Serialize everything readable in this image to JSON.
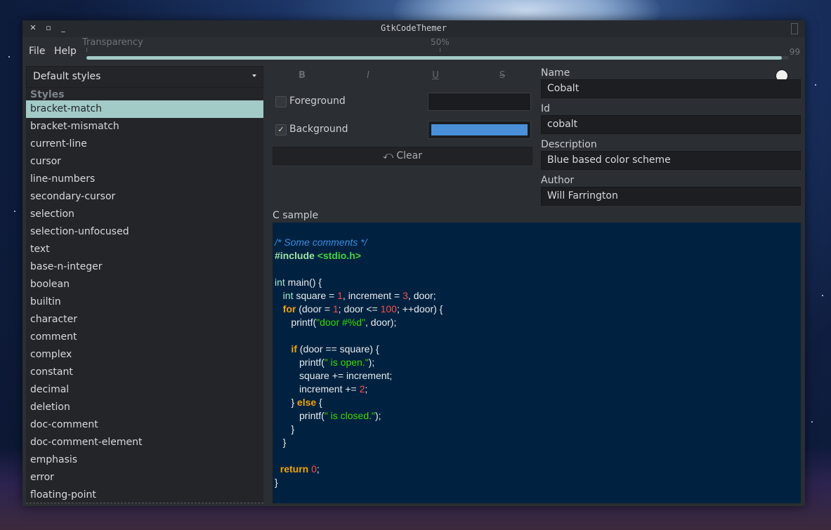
{
  "window": {
    "title": "GtkCodeThemer",
    "controls": [
      {
        "icon": "close-icon",
        "glyph": "✕"
      },
      {
        "icon": "maximize-icon",
        "glyph": "▫"
      },
      {
        "icon": "minimize-icon",
        "glyph": "_"
      }
    ]
  },
  "menu": {
    "file": "File",
    "help": "Help"
  },
  "transparency": {
    "caption": "Transparency",
    "mid_mark": "50%",
    "value": "99",
    "fraction": 0.99
  },
  "scheme_select": {
    "selected": "Default styles"
  },
  "styles_list": {
    "header": "Styles",
    "items": [
      "bracket-match",
      "bracket-mismatch",
      "current-line",
      "cursor",
      "line-numbers",
      "secondary-cursor",
      "selection",
      "selection-unfocused",
      "text",
      "base-n-integer",
      "boolean",
      "builtin",
      "character",
      "comment",
      "complex",
      "constant",
      "decimal",
      "deletion",
      "doc-comment",
      "doc-comment-element",
      "emphasis",
      "error",
      "floating-point"
    ],
    "selected_index": 0
  },
  "format_buttons": {
    "bold": "B",
    "italic": "I",
    "underline": "U",
    "strike": "S"
  },
  "foreground": {
    "label": "Foreground",
    "checked": false,
    "color": "#1a1c1f"
  },
  "background": {
    "label": "Background",
    "checked": true,
    "check_glyph": "✓",
    "color": "#4a90d9"
  },
  "clear_button": {
    "icon": "undo-icon",
    "glyph": "⤺",
    "label": "Clear"
  },
  "scheme": {
    "name_label": "Name",
    "name": "Cobalt",
    "id_label": "Id",
    "id": "cobalt",
    "description_label": "Description",
    "description": "Blue based color scheme",
    "author_label": "Author",
    "author": "Will Farrington"
  },
  "sample": {
    "label": "C sample",
    "lines": [
      [],
      [
        {
          "t": "/* Some comments */",
          "c": "comment"
        }
      ],
      [
        {
          "t": "#include ",
          "c": "pre"
        },
        {
          "t": "<stdio.h>",
          "c": "incl"
        }
      ],
      [],
      [
        {
          "t": "int",
          "c": "type"
        },
        {
          "t": " main() {"
        }
      ],
      [
        {
          "t": "   "
        },
        {
          "t": "int",
          "c": "type"
        },
        {
          "t": " square = "
        },
        {
          "t": "1",
          "c": "num"
        },
        {
          "t": ", increment = "
        },
        {
          "t": "3",
          "c": "num"
        },
        {
          "t": ", door;"
        }
      ],
      [
        {
          "t": "   "
        },
        {
          "t": "for",
          "c": "kw"
        },
        {
          "t": " (door = "
        },
        {
          "t": "1",
          "c": "num"
        },
        {
          "t": "; door <= "
        },
        {
          "t": "100",
          "c": "num"
        },
        {
          "t": "; ++door) {"
        }
      ],
      [
        {
          "t": "      printf("
        },
        {
          "t": "\"door #%d\"",
          "c": "str"
        },
        {
          "t": ", door);"
        }
      ],
      [],
      [
        {
          "t": "      "
        },
        {
          "t": "if",
          "c": "kw"
        },
        {
          "t": " (door == square) {"
        }
      ],
      [
        {
          "t": "         printf("
        },
        {
          "t": "\" is open.\"",
          "c": "str"
        },
        {
          "t": ");"
        }
      ],
      [
        {
          "t": "         square += increment;"
        }
      ],
      [
        {
          "t": "         increment += "
        },
        {
          "t": "2",
          "c": "num"
        },
        {
          "t": ";"
        }
      ],
      [
        {
          "t": "      } "
        },
        {
          "t": "else",
          "c": "kw"
        },
        {
          "t": " {"
        }
      ],
      [
        {
          "t": "         printf("
        },
        {
          "t": "\" is closed.\"",
          "c": "str"
        },
        {
          "t": ");"
        }
      ],
      [
        {
          "t": "      }"
        }
      ],
      [
        {
          "t": "   }"
        }
      ],
      [],
      [
        {
          "t": "  "
        },
        {
          "t": "return",
          "c": "kw"
        },
        {
          "t": " "
        },
        {
          "t": "0",
          "c": "num"
        },
        {
          "t": ";"
        }
      ],
      [
        {
          "t": "}"
        }
      ]
    ]
  },
  "colors": {
    "accent": "#a2cac6",
    "code_background": "#002240"
  }
}
